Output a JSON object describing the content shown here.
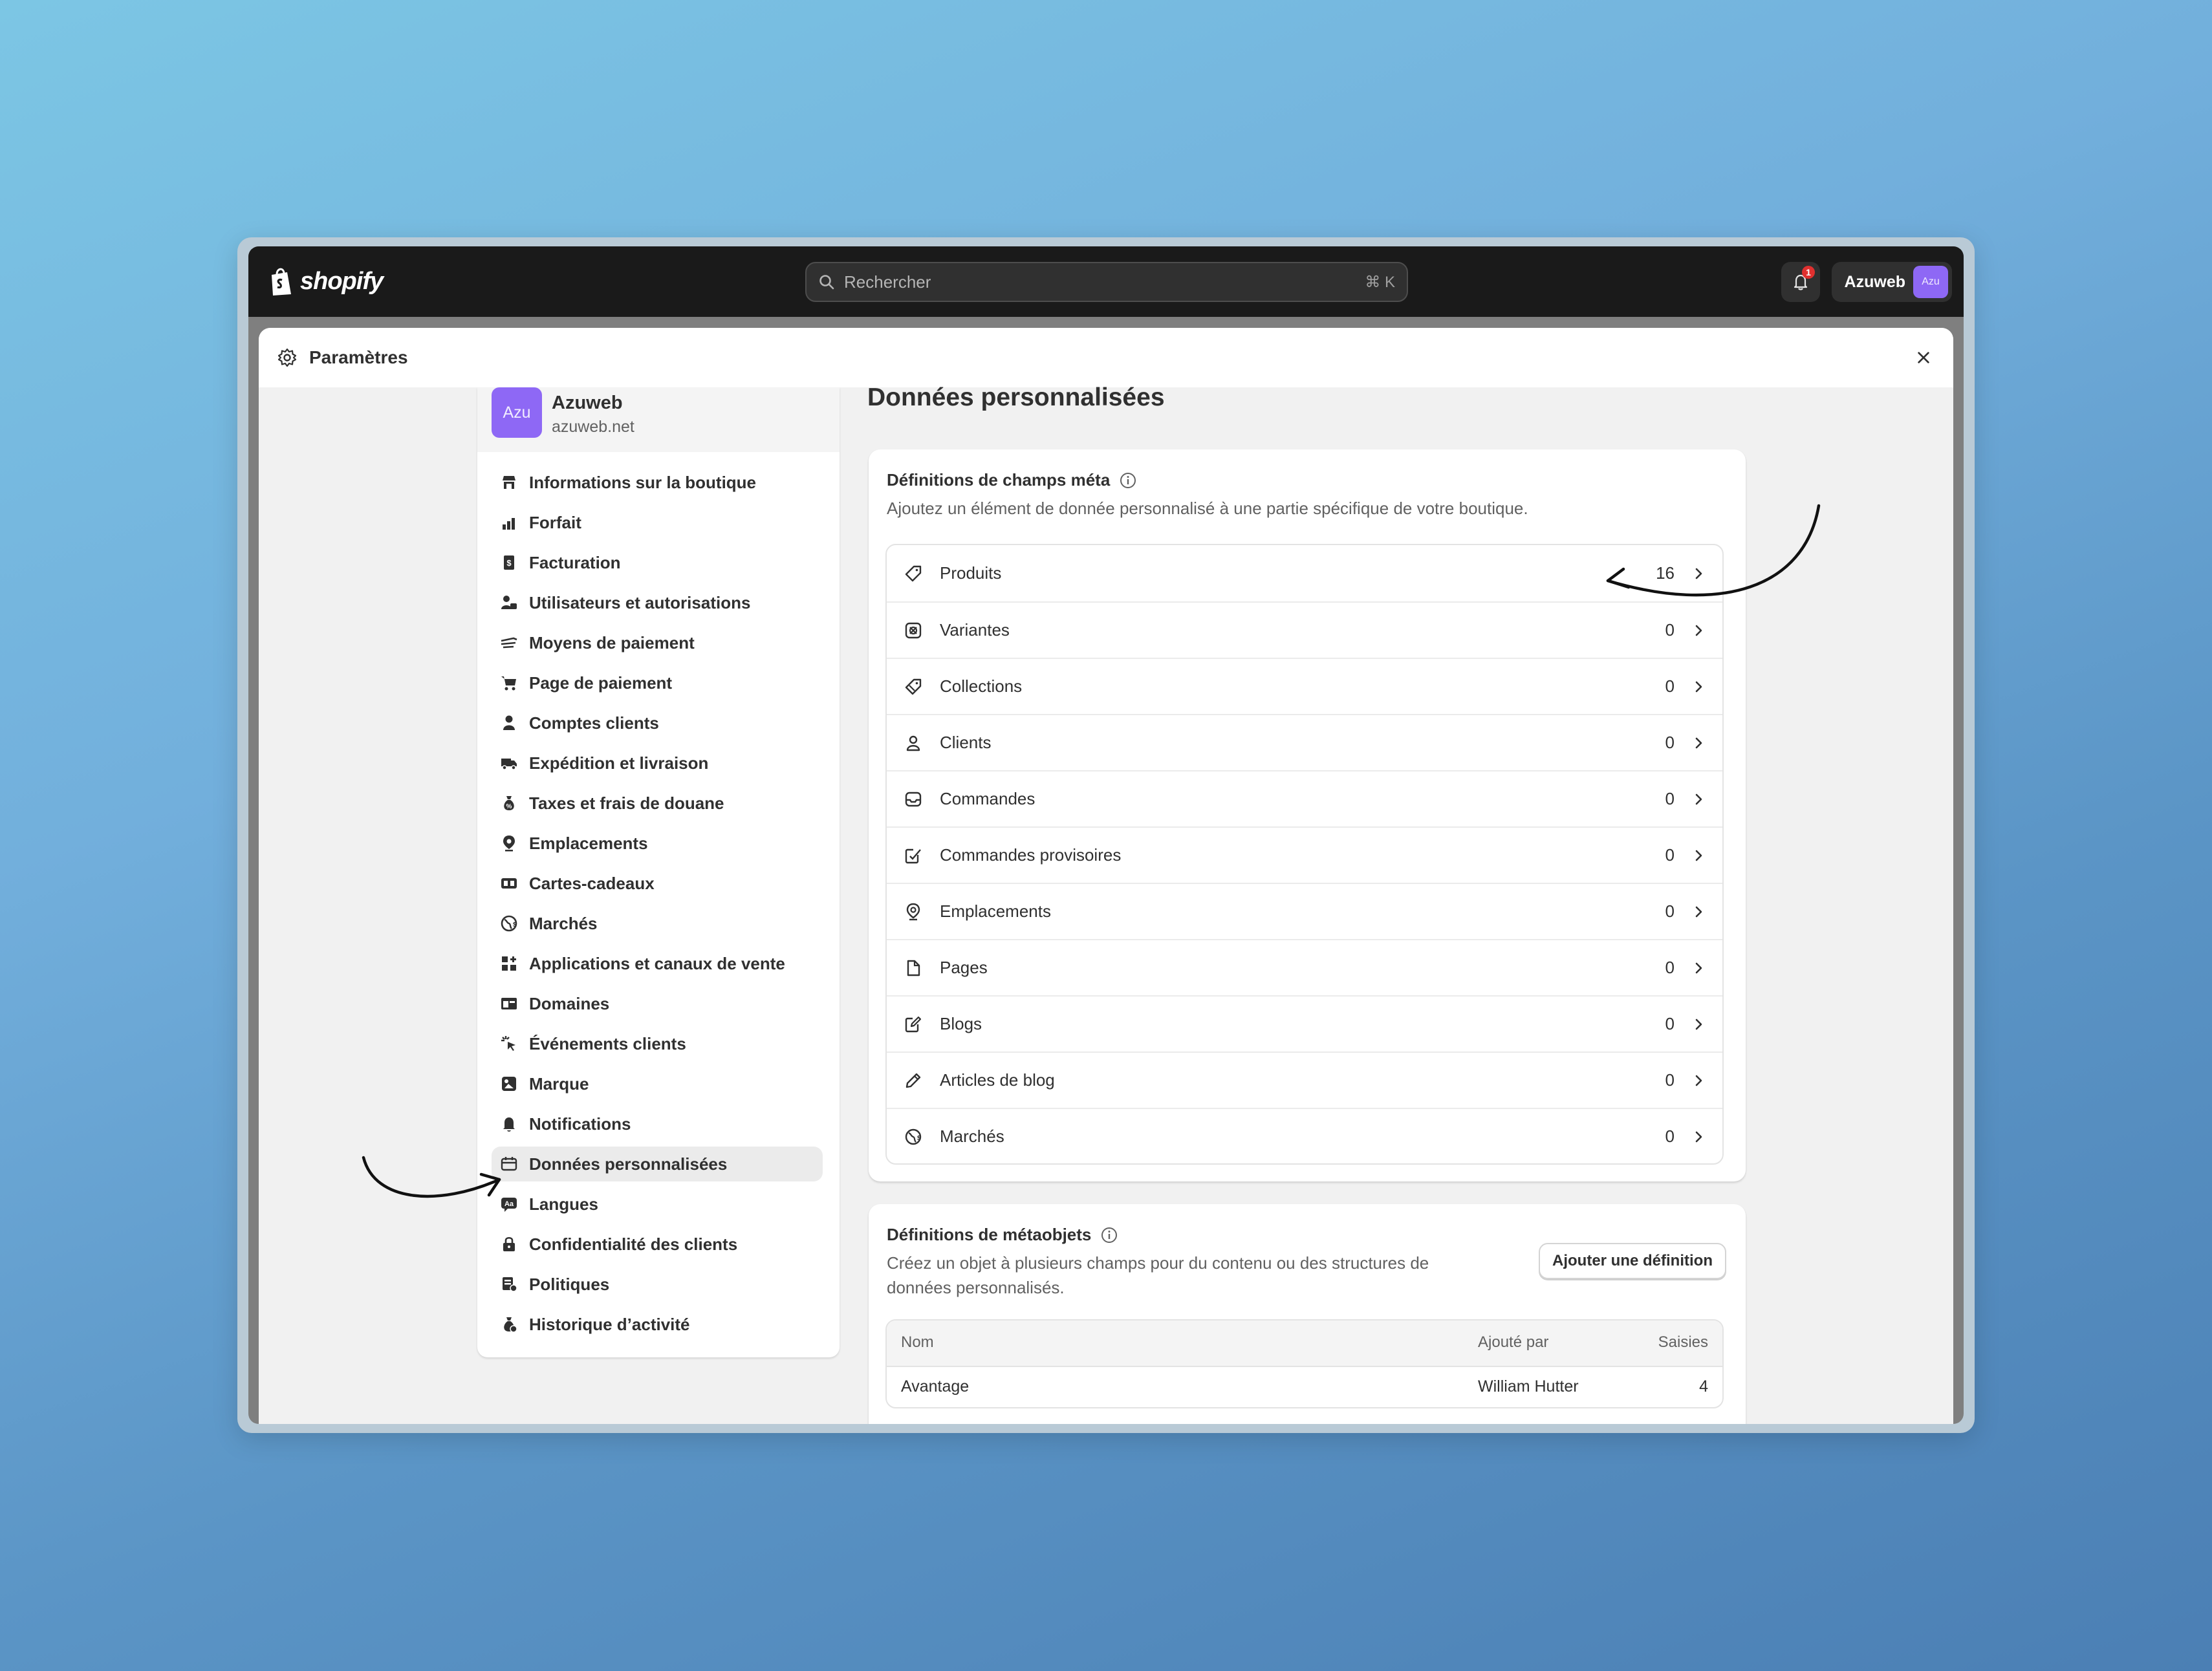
{
  "topbar": {
    "brand": "shopify",
    "search_placeholder": "Rechercher",
    "search_shortcut": "⌘ K",
    "notification_count": "1",
    "user_name": "Azuweb",
    "user_avatar": "Azu"
  },
  "modal": {
    "title": "Paramètres",
    "close_label": "×"
  },
  "store": {
    "avatar": "Azu",
    "name": "Azuweb",
    "domain": "azuweb.net"
  },
  "sidebar": {
    "items": [
      {
        "label": "Informations sur la boutique",
        "icon": "store-icon"
      },
      {
        "label": "Forfait",
        "icon": "plan-icon"
      },
      {
        "label": "Facturation",
        "icon": "billing-icon"
      },
      {
        "label": "Utilisateurs et autorisations",
        "icon": "users-icon"
      },
      {
        "label": "Moyens de paiement",
        "icon": "payments-icon"
      },
      {
        "label": "Page de paiement",
        "icon": "cart-icon"
      },
      {
        "label": "Comptes clients",
        "icon": "person-icon"
      },
      {
        "label": "Expédition et livraison",
        "icon": "truck-icon"
      },
      {
        "label": "Taxes et frais de douane",
        "icon": "money-bag-icon"
      },
      {
        "label": "Emplacements",
        "icon": "location-icon"
      },
      {
        "label": "Cartes-cadeaux",
        "icon": "gift-card-icon"
      },
      {
        "label": "Marchés",
        "icon": "globe-icon"
      },
      {
        "label": "Applications et canaux de vente",
        "icon": "apps-icon"
      },
      {
        "label": "Domaines",
        "icon": "domain-icon"
      },
      {
        "label": "Événements clients",
        "icon": "cursor-click-icon"
      },
      {
        "label": "Marque",
        "icon": "brand-icon"
      },
      {
        "label": "Notifications",
        "icon": "bell-icon"
      },
      {
        "label": "Données personnalisées",
        "icon": "custom-data-icon"
      },
      {
        "label": "Langues",
        "icon": "language-icon"
      },
      {
        "label": "Confidentialité des clients",
        "icon": "lock-icon"
      },
      {
        "label": "Politiques",
        "icon": "policy-icon"
      },
      {
        "label": "Historique d’activité",
        "icon": "activity-icon"
      }
    ],
    "active_index": 17
  },
  "main": {
    "title": "Données personnalisées",
    "metafields": {
      "title": "Définitions de champs méta",
      "description": "Ajoutez un élément de donnée personnalisé à une partie spécifique de votre boutique.",
      "rows": [
        {
          "label": "Produits",
          "count": "16",
          "icon": "tag-icon"
        },
        {
          "label": "Variantes",
          "count": "0",
          "icon": "variant-icon"
        },
        {
          "label": "Collections",
          "count": "0",
          "icon": "collection-icon"
        },
        {
          "label": "Clients",
          "count": "0",
          "icon": "person-icon"
        },
        {
          "label": "Commandes",
          "count": "0",
          "icon": "inbox-icon"
        },
        {
          "label": "Commandes provisoires",
          "count": "0",
          "icon": "draft-order-icon"
        },
        {
          "label": "Emplacements",
          "count": "0",
          "icon": "location-icon"
        },
        {
          "label": "Pages",
          "count": "0",
          "icon": "page-icon"
        },
        {
          "label": "Blogs",
          "count": "0",
          "icon": "blog-icon"
        },
        {
          "label": "Articles de blog",
          "count": "0",
          "icon": "pencil-icon"
        },
        {
          "label": "Marchés",
          "count": "0",
          "icon": "globe-icon"
        }
      ]
    },
    "metaobjects": {
      "title": "Définitions de métaobjets",
      "description_line1": "Créez un objet à plusieurs champs pour du contenu ou des structures de",
      "description_line2": "données personnalisés.",
      "add_button": "Ajouter une définition",
      "columns": [
        "Nom",
        "Ajouté par",
        "Saisies"
      ],
      "rows": [
        {
          "name": "Avantage",
          "added_by": "William Hutter",
          "entries": "4"
        }
      ]
    }
  },
  "colors": {
    "accent_avatar": "#8e68f5",
    "topbar_bg": "#1a1a1a",
    "badge_red": "#e0302f"
  }
}
